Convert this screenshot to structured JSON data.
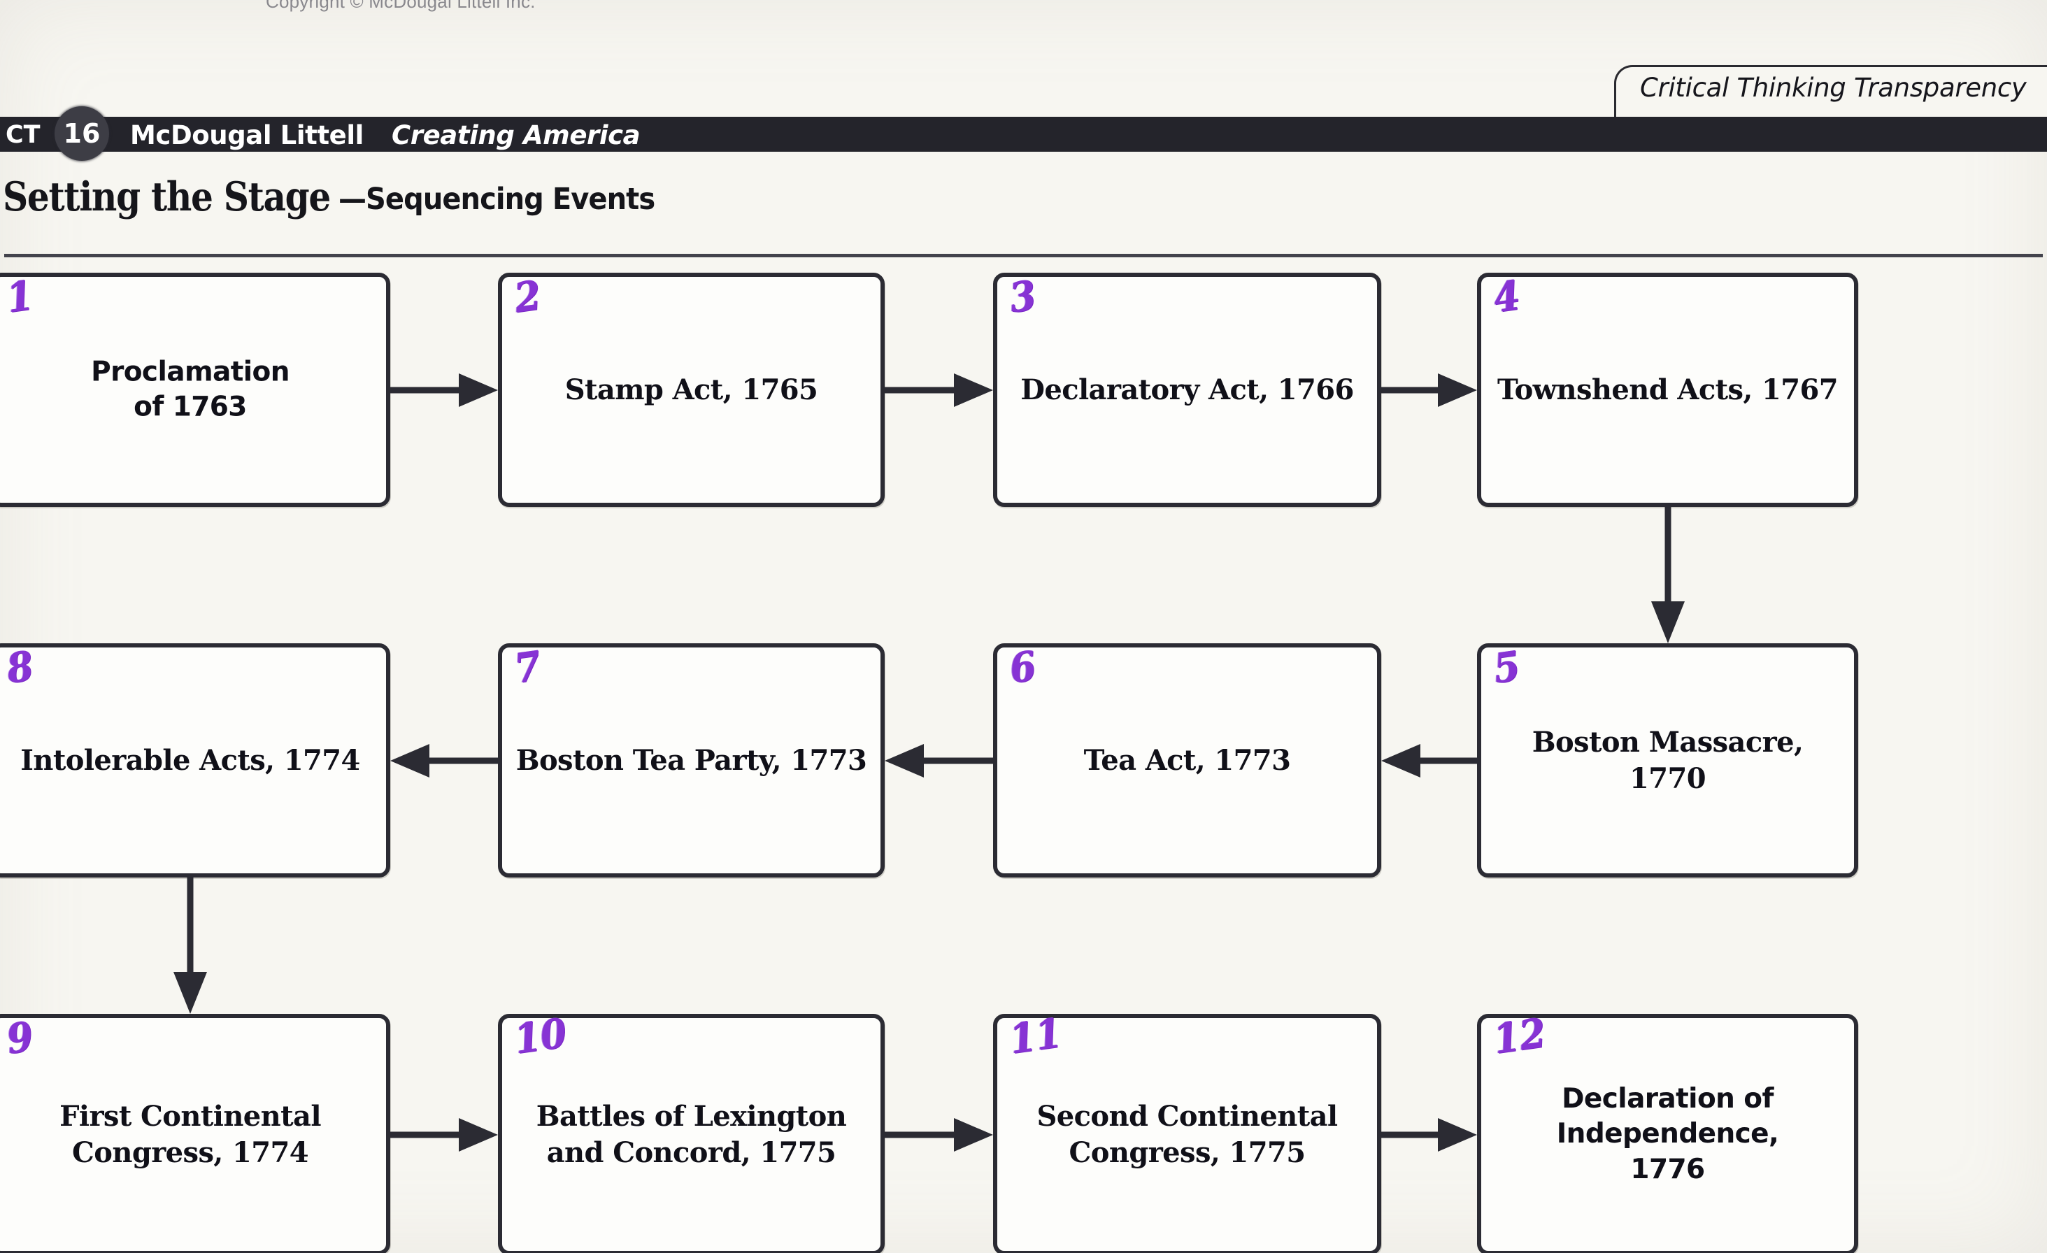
{
  "page": {
    "copyright": "Copyright © McDougal Littell Inc.",
    "background_color": "#f7f6f1",
    "ink_color": "#2b2b33",
    "marker_color": "#8733d4"
  },
  "tab": {
    "label": "Critical Thinking Transparency"
  },
  "header_bar": {
    "code": "CT",
    "number": "16",
    "publisher": "McDougal Littell",
    "series": "Creating America"
  },
  "heading": {
    "main": "Setting the Stage",
    "sub": "—Sequencing Events"
  },
  "flow": {
    "boxes": [
      {
        "n": "1",
        "text": "Proclamation\nof 1763",
        "font": "sans"
      },
      {
        "n": "2",
        "text": "Stamp Act, 1765",
        "font": "serif"
      },
      {
        "n": "3",
        "text": "Declaratory Act, 1766",
        "font": "serif"
      },
      {
        "n": "4",
        "text": "Townshend Acts, 1767",
        "font": "serif"
      },
      {
        "n": "5",
        "text": "Boston Massacre, 1770",
        "font": "serif"
      },
      {
        "n": "6",
        "text": "Tea Act, 1773",
        "font": "serif"
      },
      {
        "n": "7",
        "text": "Boston Tea Party, 1773",
        "font": "serif"
      },
      {
        "n": "8",
        "text": "Intolerable Acts, 1774",
        "font": "serif"
      },
      {
        "n": "9",
        "text": "First Continental\nCongress, 1774",
        "font": "serif"
      },
      {
        "n": "10",
        "text": "Battles of Lexington\nand Concord, 1775",
        "font": "serif"
      },
      {
        "n": "11",
        "text": "Second Continental\nCongress, 1775",
        "font": "serif"
      },
      {
        "n": "12",
        "text": "Declaration of\nIndependence,\n1776",
        "font": "sans"
      }
    ],
    "connections": [
      {
        "from": "1",
        "to": "2",
        "direction": "right"
      },
      {
        "from": "2",
        "to": "3",
        "direction": "right"
      },
      {
        "from": "3",
        "to": "4",
        "direction": "right"
      },
      {
        "from": "4",
        "to": "5",
        "direction": "down"
      },
      {
        "from": "5",
        "to": "6",
        "direction": "left"
      },
      {
        "from": "6",
        "to": "7",
        "direction": "left"
      },
      {
        "from": "7",
        "to": "8",
        "direction": "left"
      },
      {
        "from": "8",
        "to": "9",
        "direction": "down"
      },
      {
        "from": "9",
        "to": "10",
        "direction": "right"
      },
      {
        "from": "10",
        "to": "11",
        "direction": "right"
      },
      {
        "from": "11",
        "to": "12",
        "direction": "right"
      }
    ]
  }
}
